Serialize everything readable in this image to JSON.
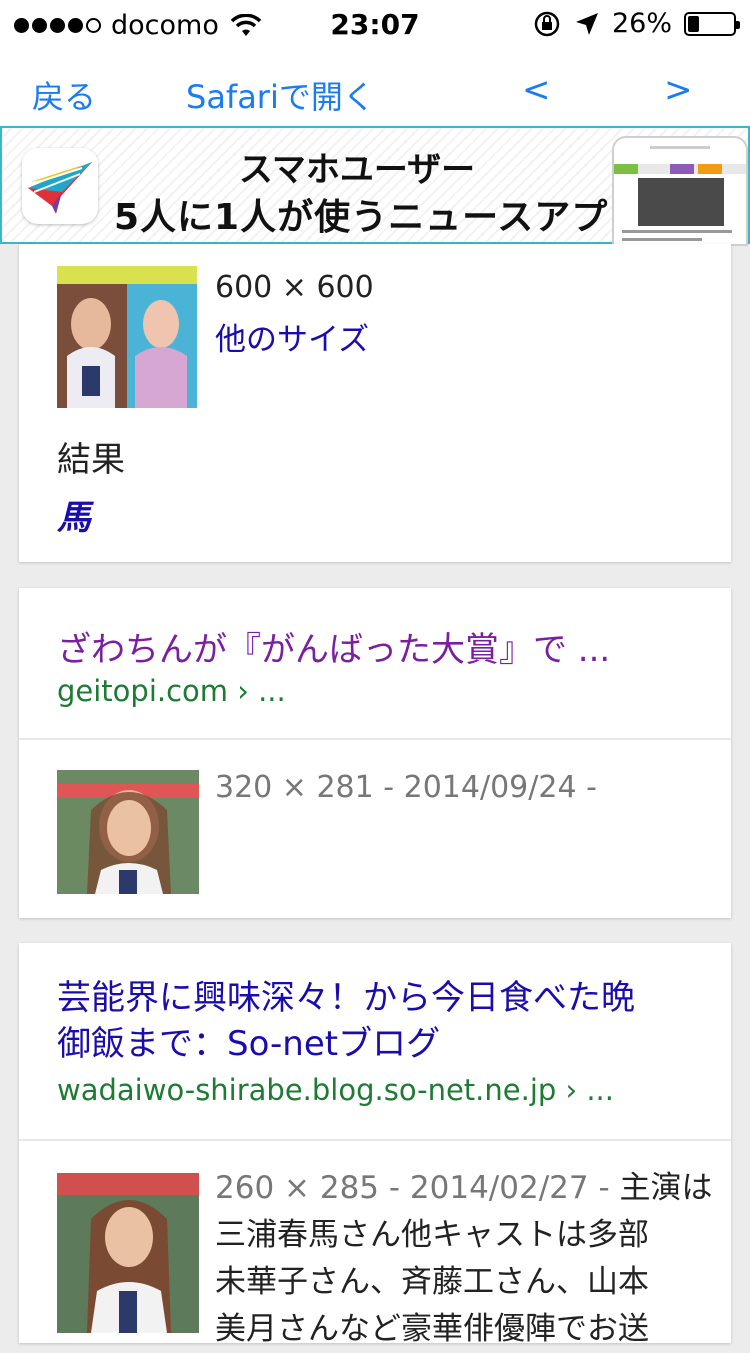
{
  "status_bar": {
    "carrier": "docomo",
    "time": "23:07",
    "battery": "26%",
    "battery_level": 0.26,
    "signal_bars_filled": 4,
    "signal_bars_total": 5
  },
  "nav": {
    "back": "戻る",
    "open_in_safari": "Safariで開く",
    "prev": "<",
    "next": ">"
  },
  "ad": {
    "line1": "スマホユーザー",
    "line2": "5人に1人が使うニュースアプリ"
  },
  "result1": {
    "size": "600 × 600",
    "other_sizes": "他のサイズ",
    "result_label": "結果",
    "result_link": "馬"
  },
  "result2": {
    "title": "ざわちんが『がんばった大賞』で ...",
    "cite": "geitopi.com › ...",
    "meta": "320 × 281 - 2014/09/24 -"
  },
  "result3": {
    "title_line1": "芸能界に興味深々！から今日食べた晩",
    "title_line2": "御飯まで：So-netブログ",
    "cite": "wadaiwo-shirabe.blog.so-net.ne.jp › ...",
    "meta": "260 × 285 - 2014/02/27 -",
    "snippet_line1_rest": " 主演は",
    "snippet_line2": "三浦春馬さん他キャストは多部",
    "snippet_line3": "未華子さん、斉藤工さん、山本",
    "snippet_line4": "美月さんなど豪華俳優陣でお送"
  },
  "colors": {
    "link": "#1a0dab",
    "visited": "#7b1fa2",
    "cite": "#1e7b34",
    "ios_blue": "#1b7bf1",
    "ad_border": "#39b8c9"
  }
}
